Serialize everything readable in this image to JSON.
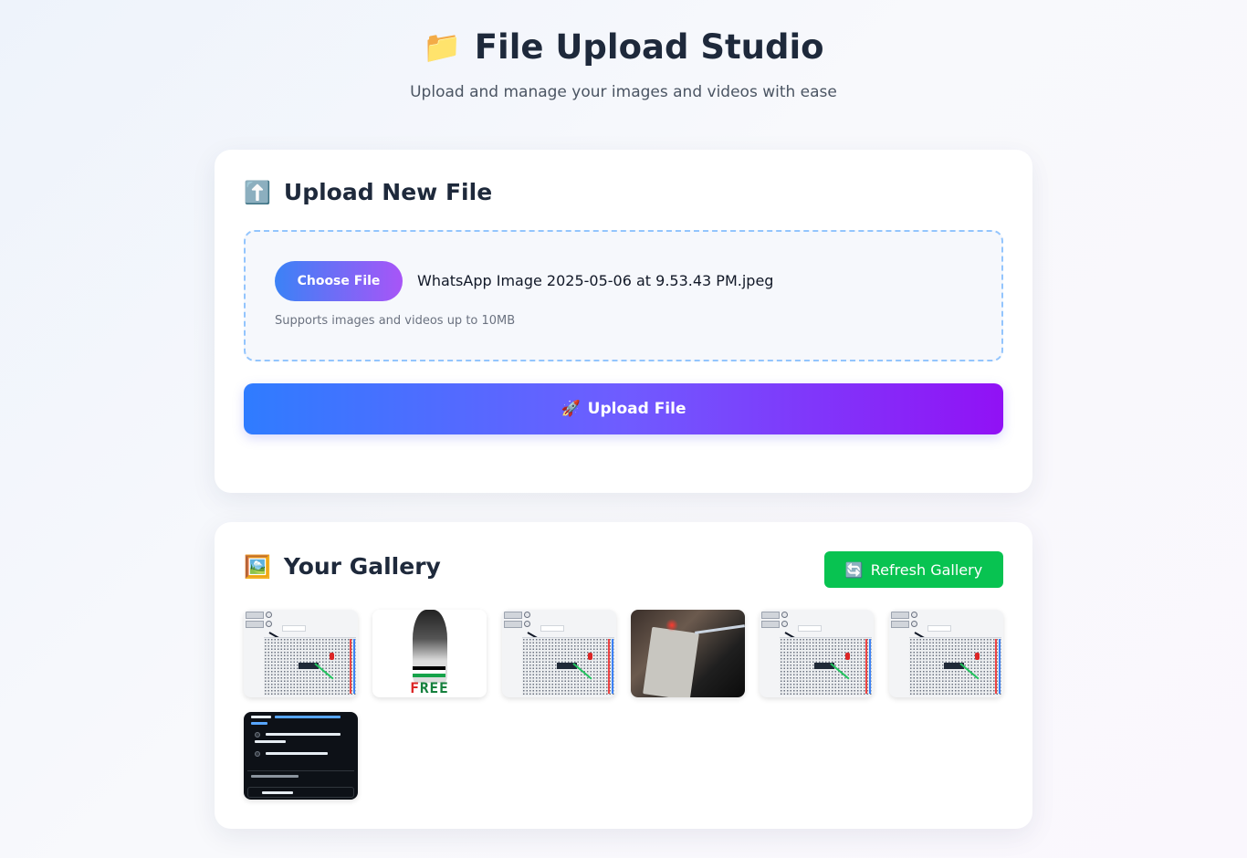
{
  "header": {
    "icon": "folder-icon",
    "title": "File Upload Studio",
    "subtitle": "Upload and manage your images and videos with ease"
  },
  "upload": {
    "icon": "up-arrow-icon",
    "title": "Upload New File",
    "choose_label": "Choose File",
    "selected_file": "WhatsApp Image 2025-05-06 at 9.53.43 PM.jpeg",
    "hint": "Supports images and videos up to 10MB",
    "button_icon": "rocket-icon",
    "button_label": "Upload File"
  },
  "gallery": {
    "icon": "framed-picture-icon",
    "title": "Your Gallery",
    "refresh_icon": "refresh-icon",
    "refresh_label": "Refresh Gallery",
    "items": [
      {
        "kind": "breadboard-screenshot"
      },
      {
        "kind": "poster",
        "text": "FREE"
      },
      {
        "kind": "breadboard-screenshot"
      },
      {
        "kind": "breadboard-photo"
      },
      {
        "kind": "breadboard-screenshot"
      },
      {
        "kind": "breadboard-screenshot"
      },
      {
        "kind": "dark-screenshot"
      }
    ]
  },
  "colors": {
    "accent_start": "#2f7cff",
    "accent_end": "#9111f5",
    "refresh": "#08c351",
    "dropzone_border": "#93c5fd"
  }
}
